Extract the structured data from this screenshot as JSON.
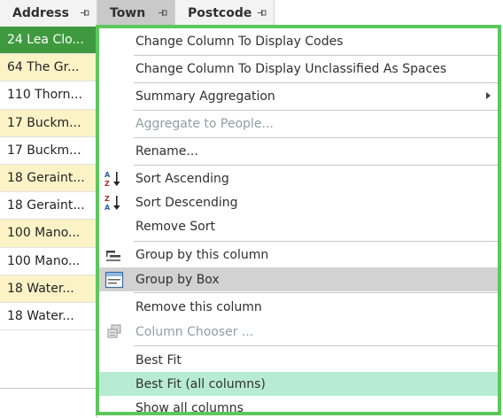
{
  "grid": {
    "columns": [
      {
        "label": "Address"
      },
      {
        "label": "Town"
      },
      {
        "label": "Postcode"
      }
    ],
    "rows": [
      "24 Lea Clo...",
      "64 The Gr...",
      "110 Thorn...",
      "17 Buckm...",
      "17 Buckm...",
      "18 Geraint...",
      "18 Geraint...",
      "100 Mano...",
      "100 Mano...",
      "18 Water...",
      "18 Water..."
    ]
  },
  "menu": {
    "items": [
      {
        "label": "Change Column To Display Codes"
      },
      {
        "label": "Change Column To Display Unclassified As Spaces"
      },
      {
        "label": "Summary Aggregation",
        "submenu": true
      },
      {
        "label": "Aggregate to People...",
        "disabled": true
      },
      {
        "label": "Rename..."
      },
      {
        "label": "Sort Ascending",
        "icon": "sort-ascending-icon"
      },
      {
        "label": "Sort Descending",
        "icon": "sort-descending-icon"
      },
      {
        "label": "Remove Sort"
      },
      {
        "label": "Group by this column",
        "icon": "group-by-column-icon"
      },
      {
        "label": "Group by Box",
        "icon": "group-by-box-icon"
      },
      {
        "label": "Remove this column"
      },
      {
        "label": "Column Chooser ...",
        "disabled": true,
        "icon": "column-chooser-icon"
      },
      {
        "label": "Best Fit"
      },
      {
        "label": "Best Fit (all columns)"
      },
      {
        "label": "Show all columns"
      }
    ]
  },
  "colors": {
    "selected_row": "#3f9a3f",
    "alt_row": "#fbf3c6",
    "menu_border": "#5cc85c",
    "hover_item": "#d2d2d2",
    "highlight_item": "#b7ecd3"
  }
}
